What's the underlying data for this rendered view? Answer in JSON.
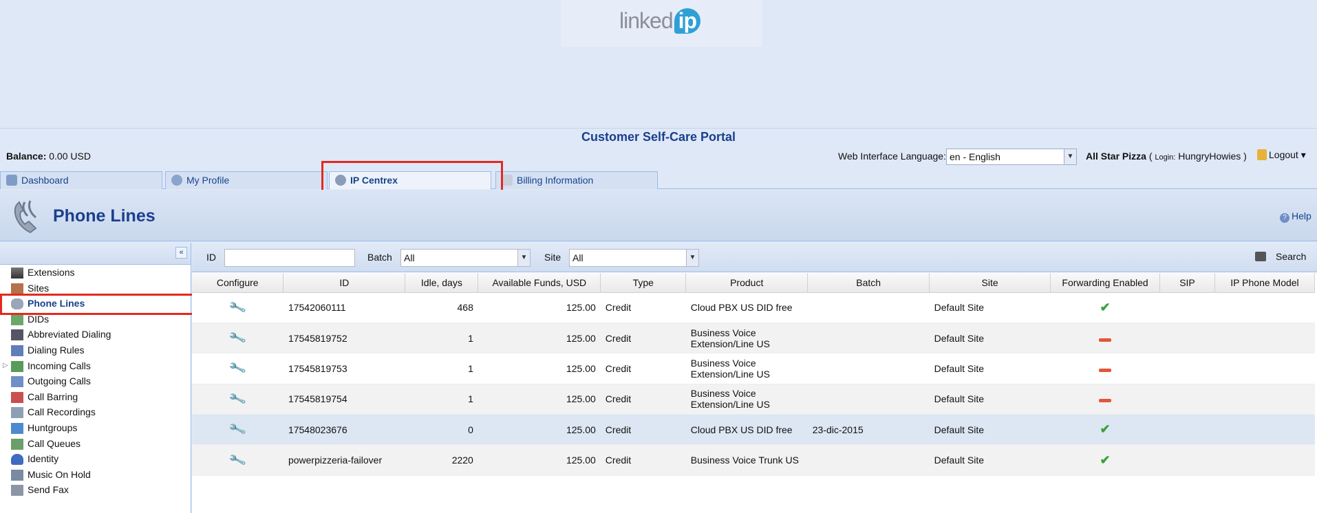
{
  "header": {
    "logo_text": "linked",
    "logo_ip": "ip",
    "portal_title": "Customer Self-Care Portal"
  },
  "infobar": {
    "balance_label": "Balance:",
    "balance_value": "0.00 USD",
    "language_label": "Web Interface Language:",
    "language_value": "en - English",
    "account_name": "All Star Pizza",
    "login_prefix": "( ",
    "login_label": "Login:",
    "login_value": " HungryHowies )",
    "logout_label": "Logout"
  },
  "tabs": [
    {
      "label": "Dashboard",
      "icon": "dashboard-icon",
      "active": false
    },
    {
      "label": "My Profile",
      "icon": "user-icon",
      "active": false
    },
    {
      "label": "IP Centrex",
      "icon": "gear-icon",
      "active": true
    },
    {
      "label": "Billing Information",
      "icon": "document-icon",
      "active": false
    }
  ],
  "page": {
    "title": "Phone Lines",
    "help_label": "Help"
  },
  "sidebar": {
    "items": [
      {
        "label": "Extensions",
        "icon": "extensions-icon"
      },
      {
        "label": "Sites",
        "icon": "sites-icon"
      },
      {
        "label": "Phone Lines",
        "icon": "phone-lines-icon",
        "selected": true
      },
      {
        "label": "DIDs",
        "icon": "dids-icon"
      },
      {
        "label": "Abbreviated Dialing",
        "icon": "abbreviated-dialing-icon"
      },
      {
        "label": "Dialing Rules",
        "icon": "dialing-rules-icon"
      },
      {
        "label": "Incoming Calls",
        "icon": "incoming-calls-icon",
        "expandable": true
      },
      {
        "label": "Outgoing Calls",
        "icon": "outgoing-calls-icon"
      },
      {
        "label": "Call Barring",
        "icon": "call-barring-icon"
      },
      {
        "label": "Call Recordings",
        "icon": "call-recordings-icon"
      },
      {
        "label": "Huntgroups",
        "icon": "huntgroups-icon"
      },
      {
        "label": "Call Queues",
        "icon": "call-queues-icon"
      },
      {
        "label": "Identity",
        "icon": "identity-icon"
      },
      {
        "label": "Music On Hold",
        "icon": "music-on-hold-icon"
      },
      {
        "label": "Send Fax",
        "icon": "send-fax-icon"
      }
    ]
  },
  "filters": {
    "id_label": "ID",
    "id_value": "",
    "batch_label": "Batch",
    "batch_value": "All",
    "site_label": "Site",
    "site_value": "All",
    "search_label": "Search"
  },
  "table": {
    "columns": [
      "Configure",
      "ID",
      "Idle, days",
      "Available Funds, USD",
      "Type",
      "Product",
      "Batch",
      "Site",
      "Forwarding Enabled",
      "SIP",
      "IP Phone Model"
    ],
    "rows": [
      {
        "id": "17542060111",
        "idle": "468",
        "funds": "125.00",
        "type": "Credit",
        "product": "Cloud PBX US DID free",
        "batch": "",
        "site": "Default Site",
        "forwarding": true,
        "sip": "",
        "model": ""
      },
      {
        "id": "17545819752",
        "idle": "1",
        "funds": "125.00",
        "type": "Credit",
        "product": "Business Voice Extension/Line US",
        "batch": "",
        "site": "Default Site",
        "forwarding": false,
        "sip": "",
        "model": ""
      },
      {
        "id": "17545819753",
        "idle": "1",
        "funds": "125.00",
        "type": "Credit",
        "product": "Business Voice Extension/Line US",
        "batch": "",
        "site": "Default Site",
        "forwarding": false,
        "sip": "",
        "model": ""
      },
      {
        "id": "17545819754",
        "idle": "1",
        "funds": "125.00",
        "type": "Credit",
        "product": "Business Voice Extension/Line US",
        "batch": "",
        "site": "Default Site",
        "forwarding": false,
        "sip": "",
        "model": ""
      },
      {
        "id": "17548023676",
        "idle": "0",
        "funds": "125.00",
        "type": "Credit",
        "product": "Cloud PBX US DID free",
        "batch": "23-dic-2015",
        "site": "Default Site",
        "forwarding": true,
        "sip": "",
        "model": ""
      },
      {
        "id": "powerpizzeria-failover",
        "idle": "2220",
        "funds": "125.00",
        "type": "Credit",
        "product": "Business Voice Trunk US",
        "batch": "",
        "site": "Default Site",
        "forwarding": true,
        "sip": "",
        "model": ""
      }
    ]
  },
  "colors": {
    "accent": "#15428b",
    "highlight_box": "#e3291f",
    "check": "#3aa13a",
    "dash": "#e0573a"
  }
}
